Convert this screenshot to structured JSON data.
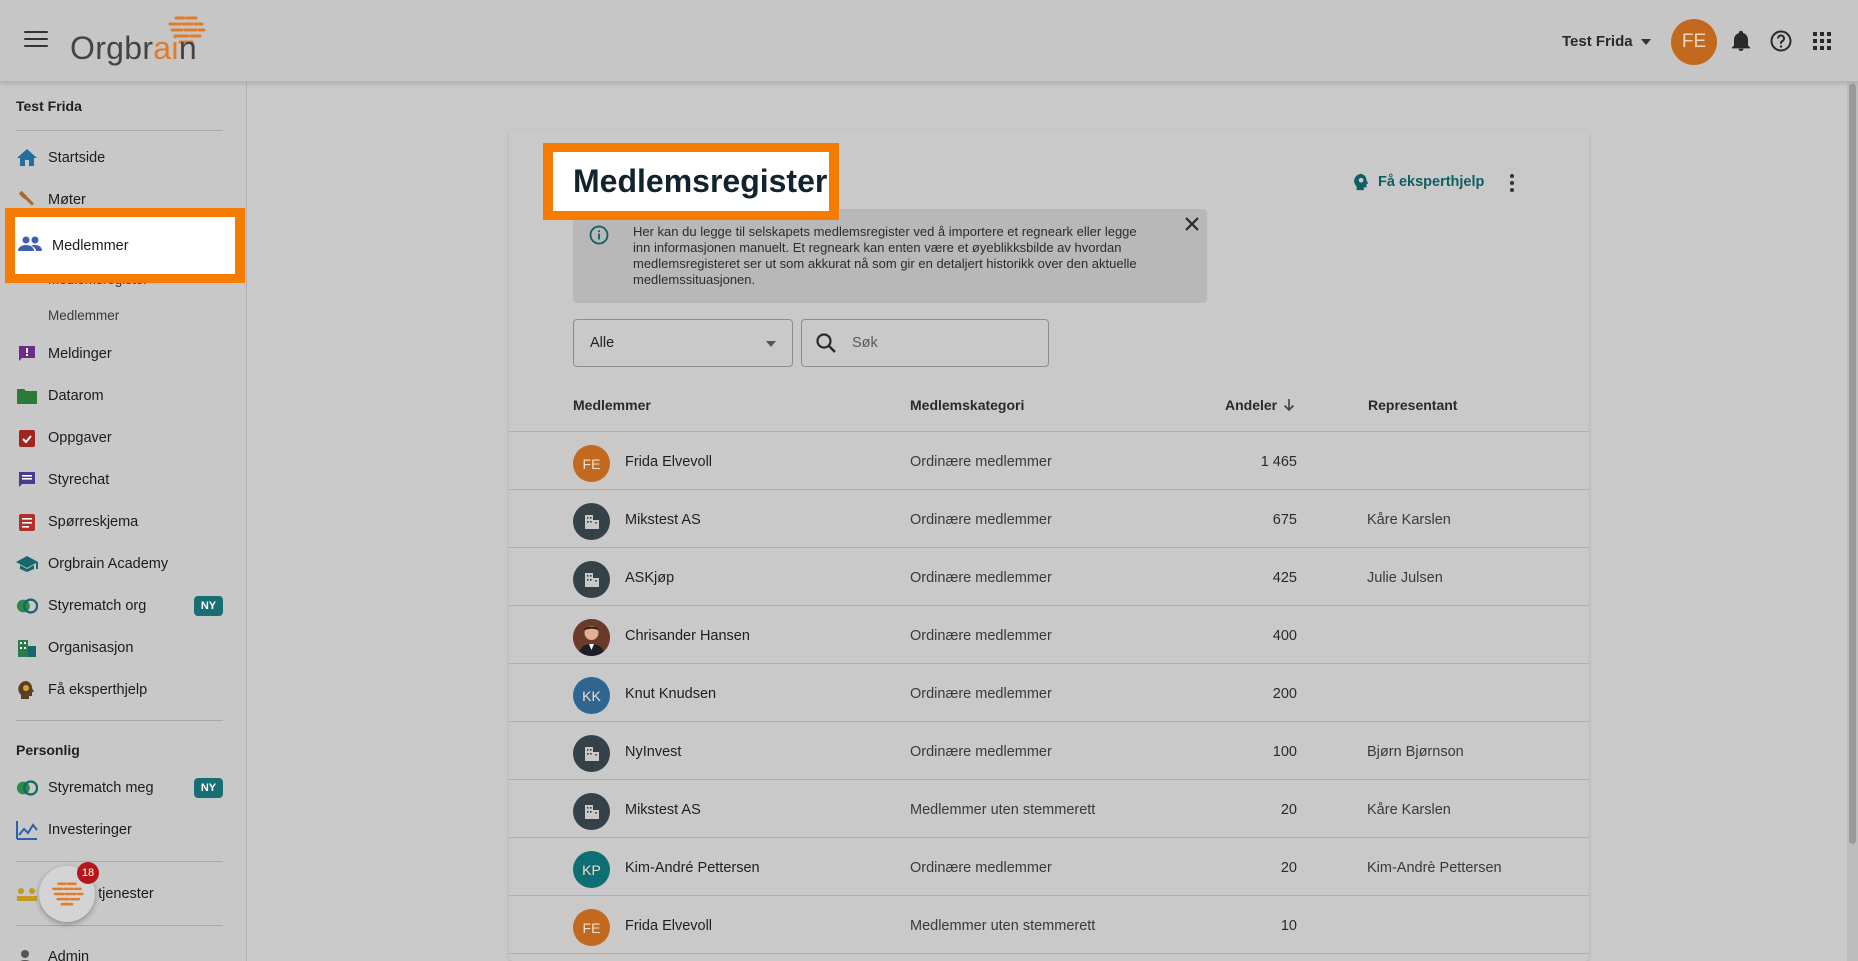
{
  "header": {
    "logo_text_a": "Orgbr",
    "logo_text_b": "ai",
    "logo_text_c": "n",
    "user_name": "Test Frida",
    "avatar_initials": "FE"
  },
  "sidebar": {
    "org_name": "Test Frida",
    "items": [
      {
        "label": "Startside"
      },
      {
        "label": "Møter"
      },
      {
        "label": "Medlemmer"
      },
      {
        "label": "Medlemsregister"
      },
      {
        "label": "Medlemmer"
      },
      {
        "label": "Meldinger"
      },
      {
        "label": "Datarom"
      },
      {
        "label": "Oppgaver"
      },
      {
        "label": "Styrechat"
      },
      {
        "label": "Spørreskjema"
      },
      {
        "label": "Orgbrain Academy"
      },
      {
        "label": "Styrematch org",
        "badge": "NY"
      },
      {
        "label": "Organisasjon"
      },
      {
        "label": "Få eksperthjelp"
      }
    ],
    "personal_title": "Personlig",
    "personal_items": [
      {
        "label": "Styrematch meg",
        "badge": "NY"
      },
      {
        "label": "Investeringer"
      }
    ],
    "services_label": "e tjenester",
    "admin_label": "Admin",
    "fab_badge": "18"
  },
  "main": {
    "title": "Medlemsregister",
    "expert_help": "Få eksperthjelp",
    "info_text": "Her kan du legge til selskapets medlemsregister ved å importere et regneark eller legge inn informasjonen manuelt. Et regneark kan enten være et øyeblikksbilde av hvordan medlemsregisteret ser ut som akkurat nå som gir en detaljert historikk over den aktuelle medlemssituasjonen.",
    "filter_value": "Alle",
    "search_placeholder": "Søk",
    "columns": [
      "Medlemmer",
      "Medlemskategori",
      "Andeler",
      "Representant"
    ],
    "rows": [
      {
        "avatar": "FE",
        "avatar_type": "orange",
        "name": "Frida Elvevoll",
        "category": "Ordinære medlemmer",
        "shares": "1 465",
        "rep": ""
      },
      {
        "avatar": "",
        "avatar_type": "company",
        "name": "Mikstest AS",
        "category": "Ordinære medlemmer",
        "shares": "675",
        "rep": "Kåre Karslen"
      },
      {
        "avatar": "",
        "avatar_type": "company",
        "name": "ASKjøp",
        "category": "Ordinære medlemmer",
        "shares": "425",
        "rep": "Julie Julsen"
      },
      {
        "avatar": "",
        "avatar_type": "photo",
        "name": "Chrisander Hansen",
        "category": "Ordinære medlemmer",
        "shares": "400",
        "rep": ""
      },
      {
        "avatar": "KK",
        "avatar_type": "blue",
        "name": "Knut Knudsen",
        "category": "Ordinære medlemmer",
        "shares": "200",
        "rep": ""
      },
      {
        "avatar": "",
        "avatar_type": "company",
        "name": "NyInvest",
        "category": "Ordinære medlemmer",
        "shares": "100",
        "rep": "Bjørn Bjørnson"
      },
      {
        "avatar": "",
        "avatar_type": "company",
        "name": "Mikstest AS",
        "category": "Medlemmer uten stemmerett",
        "shares": "20",
        "rep": "Kåre Karslen"
      },
      {
        "avatar": "KP",
        "avatar_type": "teal",
        "name": "Kim-André Pettersen",
        "category": "Ordinære medlemmer",
        "shares": "20",
        "rep": "Kim-Andrè Pettersen"
      },
      {
        "avatar": "FE",
        "avatar_type": "orange",
        "name": "Frida Elvevoll",
        "category": "Medlemmer uten stemmerett",
        "shares": "10",
        "rep": ""
      }
    ]
  },
  "colors": {
    "accent_orange": "#f57c00",
    "teal": "#0f5e64",
    "avatar_orange": "#c2691d"
  }
}
